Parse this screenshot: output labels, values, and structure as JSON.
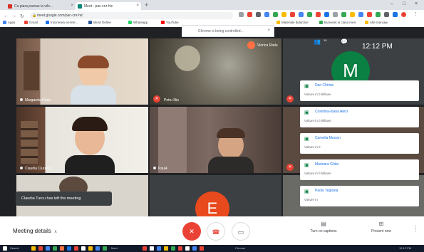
{
  "browser": {
    "tabs": [
      {
        "label": "Ca piara parnas la vilo...",
        "color": "#d93025"
      },
      {
        "label": "Meet - pac-cnr-hic",
        "color": "#00897b"
      }
    ],
    "new_tab_glyph": "+",
    "window_controls": [
      "–",
      "□",
      "×"
    ],
    "url": "meet.google.com/pac-cnr-hic",
    "bookmarks": [
      {
        "label": "Apps",
        "color": "#4285f4"
      },
      {
        "label": "Gmail",
        "color": "#ea4335"
      },
      {
        "label": "Inscrierea on-line...",
        "color": "#1a73e8"
      },
      {
        "label": "Word Online",
        "color": "#2b579a"
      },
      {
        "label": "Whatsapp",
        "color": "#25d366"
      },
      {
        "label": "YouTube",
        "color": "#ff0000"
      },
      {
        "label": "Materiale didactice",
        "color": "#fbbc04"
      },
      {
        "label": "Bunvenit in clasa mea",
        "color": "#34a853"
      },
      {
        "label": "Alte marcaje",
        "color": "#fbbc04"
      }
    ],
    "popup_text": "Chrome is being controlled..."
  },
  "meet": {
    "presenter_chip": "Viorica Radu",
    "participant_count": "19",
    "clock": "12:12 PM",
    "tiles": [
      {
        "name": "Margareta Radu",
        "muted": false
      },
      {
        "name": "Petru Niu",
        "muted": true
      },
      {
        "name": "Claudia Ciurariu",
        "muted": false
      },
      {
        "name": "Paul4",
        "muted": false
      }
    ],
    "avatar_letter_m": "M",
    "avatar_letter_e": "E",
    "notifications": [
      {
        "name": "Dan Chiriac",
        "status": "Voiture in 0 billiane"
      },
      {
        "name": "Cosmina-Ioana Alexi",
        "status": "Voiture in 0 billiane"
      },
      {
        "name": "Camelia Mocian",
        "status": "Voiture in 0"
      },
      {
        "name": "Marioara Ghita",
        "status": "Voiture in 0 billiane"
      },
      {
        "name": "Paolo Teglasia",
        "status": "Voiture in"
      }
    ],
    "toast": "Claudia Turcu has left the meeting"
  },
  "controls": {
    "meeting_details": "Meeting details",
    "turn_on_captions": "Turn on captions",
    "present_now": "Present now"
  },
  "taskbar": {
    "items": [
      "Search",
      "Meet",
      "Chrome"
    ],
    "clock": "12:12 PM"
  },
  "colors": {
    "accent_red": "#ea4335",
    "green": "#0b8043",
    "orange": "#e8491d",
    "meet_dark": "#202124"
  }
}
